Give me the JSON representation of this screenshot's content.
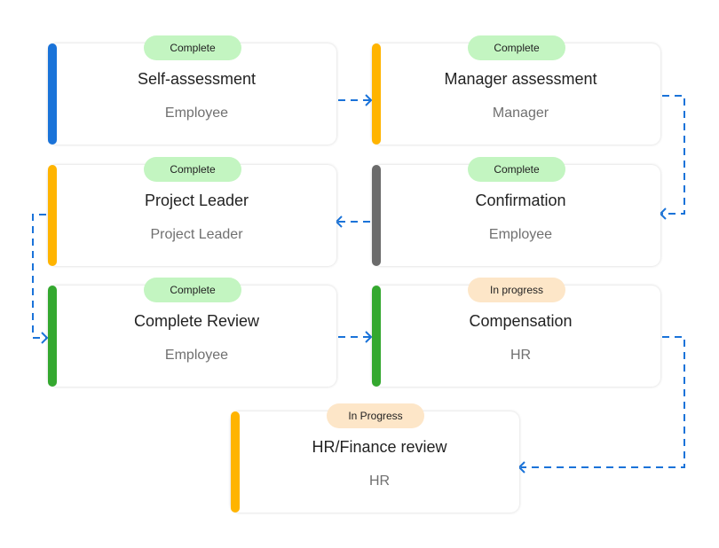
{
  "colors": {
    "complete_badge": "#c3f5c1",
    "progress_badge": "#fde6c8",
    "connector": "#1a73d9"
  },
  "steps": [
    {
      "title": "Self-assessment",
      "role": "Employee",
      "status": "Complete",
      "bar_color": "#1a73d9"
    },
    {
      "title": "Manager assessment",
      "role": "Manager",
      "status": "Complete",
      "bar_color": "#ffb400"
    },
    {
      "title": "Project Leader",
      "role": "Project Leader",
      "status": "Complete",
      "bar_color": "#ffb400"
    },
    {
      "title": "Confirmation",
      "role": "Employee",
      "status": "Complete",
      "bar_color": "#6b6b6b"
    },
    {
      "title": "Complete Review",
      "role": "Employee",
      "status": "Complete",
      "bar_color": "#34a82f"
    },
    {
      "title": "Compensation",
      "role": "HR",
      "status": "In progress",
      "bar_color": "#34a82f"
    },
    {
      "title": "HR/Finance review",
      "role": "HR",
      "status": "In Progress",
      "bar_color": "#ffb400"
    }
  ]
}
